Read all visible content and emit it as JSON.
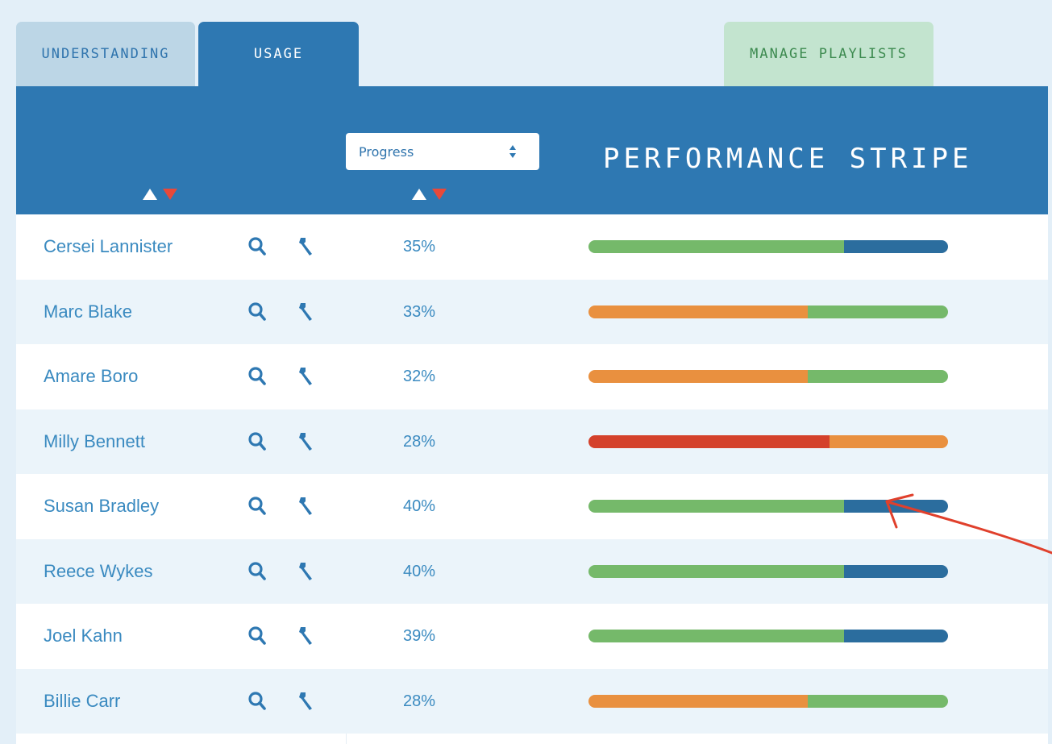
{
  "tabs": {
    "understanding": "UNDERSTANDING",
    "usage": "USAGE",
    "manage_playlists": "MANAGE PLAYLISTS"
  },
  "header": {
    "select_value": "Progress",
    "stripe_title": "PERFORMANCE STRIPE"
  },
  "colors": {
    "header_blue": "#2e78b2",
    "green": "#75b96a",
    "blue": "#2b6d9e",
    "orange": "#e9903f",
    "red": "#d4412b"
  },
  "students": [
    {
      "name": "Cersei Lannister",
      "progress": "35%",
      "stripe": [
        {
          "color": "green",
          "fraction": 0.71
        },
        {
          "color": "blue",
          "fraction": 0.29
        }
      ]
    },
    {
      "name": "Marc Blake",
      "progress": "33%",
      "stripe": [
        {
          "color": "orange",
          "fraction": 0.61
        },
        {
          "color": "green",
          "fraction": 0.39
        }
      ]
    },
    {
      "name": "Amare Boro",
      "progress": "32%",
      "stripe": [
        {
          "color": "orange",
          "fraction": 0.61
        },
        {
          "color": "green",
          "fraction": 0.39
        }
      ]
    },
    {
      "name": "Milly Bennett",
      "progress": "28%",
      "stripe": [
        {
          "color": "red",
          "fraction": 0.67
        },
        {
          "color": "orange",
          "fraction": 0.33
        }
      ]
    },
    {
      "name": "Susan Bradley",
      "progress": "40%",
      "stripe": [
        {
          "color": "green",
          "fraction": 0.71
        },
        {
          "color": "blue",
          "fraction": 0.29
        }
      ]
    },
    {
      "name": "Reece Wykes",
      "progress": "40%",
      "stripe": [
        {
          "color": "green",
          "fraction": 0.71
        },
        {
          "color": "blue",
          "fraction": 0.29
        }
      ]
    },
    {
      "name": "Joel Kahn",
      "progress": "39%",
      "stripe": [
        {
          "color": "green",
          "fraction": 0.71
        },
        {
          "color": "blue",
          "fraction": 0.29
        }
      ]
    },
    {
      "name": "Billie Carr",
      "progress": "28%",
      "stripe": [
        {
          "color": "orange",
          "fraction": 0.61
        },
        {
          "color": "green",
          "fraction": 0.39
        }
      ]
    }
  ]
}
